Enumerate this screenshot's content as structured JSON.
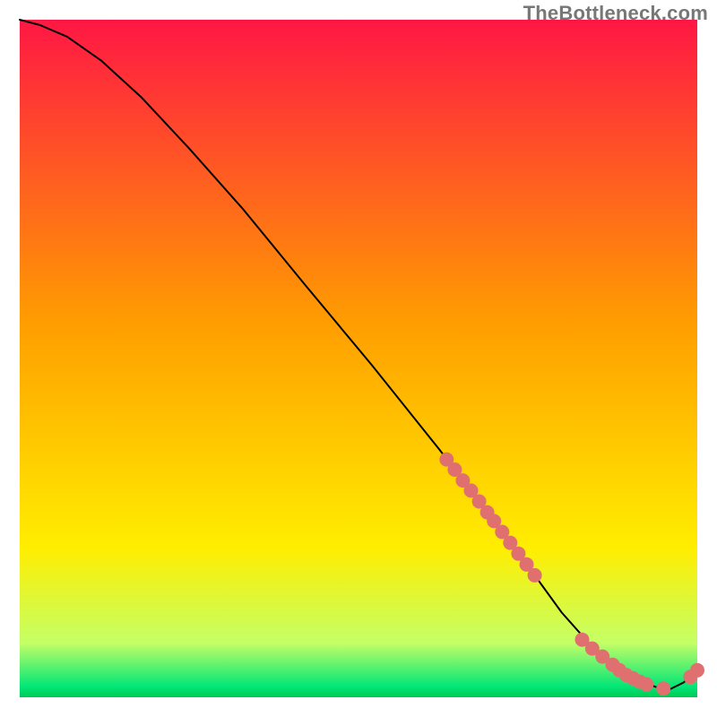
{
  "watermark": "TheBottleneck.com",
  "chart_data": {
    "type": "line",
    "title": "",
    "xlabel": "",
    "ylabel": "",
    "xlim": [
      0,
      100
    ],
    "ylim": [
      0,
      100
    ],
    "background_gradient": [
      {
        "stop": 0.0,
        "color": "#ff1744"
      },
      {
        "stop": 0.45,
        "color": "#ff9e00"
      },
      {
        "stop": 0.78,
        "color": "#ffee00"
      },
      {
        "stop": 0.92,
        "color": "#c4ff66"
      },
      {
        "stop": 0.985,
        "color": "#00e676"
      },
      {
        "stop": 1.0,
        "color": "#00c853"
      }
    ],
    "series": [
      {
        "name": "curve",
        "color": "#000000",
        "x": [
          0,
          3,
          7,
          12,
          18,
          25,
          33,
          42,
          52,
          62,
          70,
          76,
          80,
          84,
          88,
          91,
          94,
          96,
          98,
          100
        ],
        "y": [
          100,
          99.2,
          97.5,
          94,
          88.5,
          81,
          72,
          61,
          49,
          36.5,
          26,
          18,
          12.5,
          8,
          4.5,
          2.5,
          1.5,
          1.2,
          2.2,
          4
        ]
      }
    ],
    "scatter": [
      {
        "name": "cluster-steep",
        "color": "#e07070",
        "points": [
          {
            "x": 63.0,
            "y": 35.1
          },
          {
            "x": 64.2,
            "y": 33.6
          },
          {
            "x": 65.4,
            "y": 32.0
          },
          {
            "x": 66.6,
            "y": 30.5
          },
          {
            "x": 67.8,
            "y": 28.9
          },
          {
            "x": 69.0,
            "y": 27.3
          },
          {
            "x": 70.0,
            "y": 26.0
          },
          {
            "x": 71.2,
            "y": 24.4
          },
          {
            "x": 72.4,
            "y": 22.8
          },
          {
            "x": 73.6,
            "y": 21.2
          },
          {
            "x": 74.8,
            "y": 19.6
          },
          {
            "x": 76.0,
            "y": 18.0
          }
        ]
      },
      {
        "name": "cluster-flat",
        "color": "#e07070",
        "points": [
          {
            "x": 83.0,
            "y": 8.5
          },
          {
            "x": 84.5,
            "y": 7.2
          },
          {
            "x": 86.0,
            "y": 6.0
          },
          {
            "x": 87.5,
            "y": 4.8
          },
          {
            "x": 88.5,
            "y": 4.0
          },
          {
            "x": 89.5,
            "y": 3.3
          },
          {
            "x": 90.5,
            "y": 2.8
          },
          {
            "x": 91.5,
            "y": 2.3
          },
          {
            "x": 92.5,
            "y": 1.9
          },
          {
            "x": 95.0,
            "y": 1.3
          }
        ]
      },
      {
        "name": "rise-points",
        "color": "#e07070",
        "points": [
          {
            "x": 99.0,
            "y": 3.0
          },
          {
            "x": 100.0,
            "y": 4.0
          }
        ]
      }
    ]
  }
}
